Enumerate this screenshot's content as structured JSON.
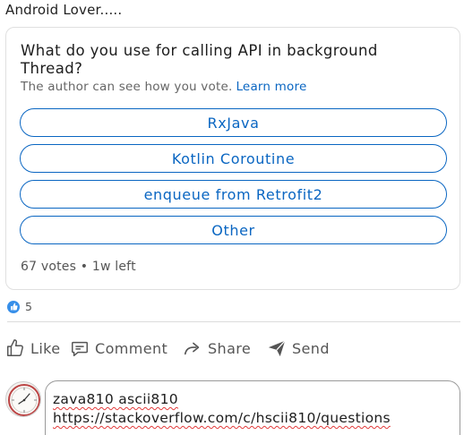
{
  "post": {
    "author_line": "Android Lover....."
  },
  "poll": {
    "question": "What do you use for calling API in background Thread?",
    "note": "The author can see how you vote.",
    "learn_more": "Learn more",
    "options": [
      {
        "label": "RxJava"
      },
      {
        "label": "Kotlin Coroutine"
      },
      {
        "label": "enqueue from Retrofit2"
      },
      {
        "label": "Other"
      }
    ],
    "meta": "67 votes • 1w left"
  },
  "reactions": {
    "count": "5",
    "icon": "thumbs-up-icon",
    "badge_color": "#378fe9"
  },
  "actions": {
    "like": "Like",
    "comment": "Comment",
    "share": "Share",
    "send": "Send"
  },
  "comment_box": {
    "line1": "zava810 ascii810",
    "line2": "https://stackoverflow.com/c/hscii810/questions"
  },
  "colors": {
    "accent": "#0a66c2",
    "spellcheck": "#e23b3b"
  }
}
